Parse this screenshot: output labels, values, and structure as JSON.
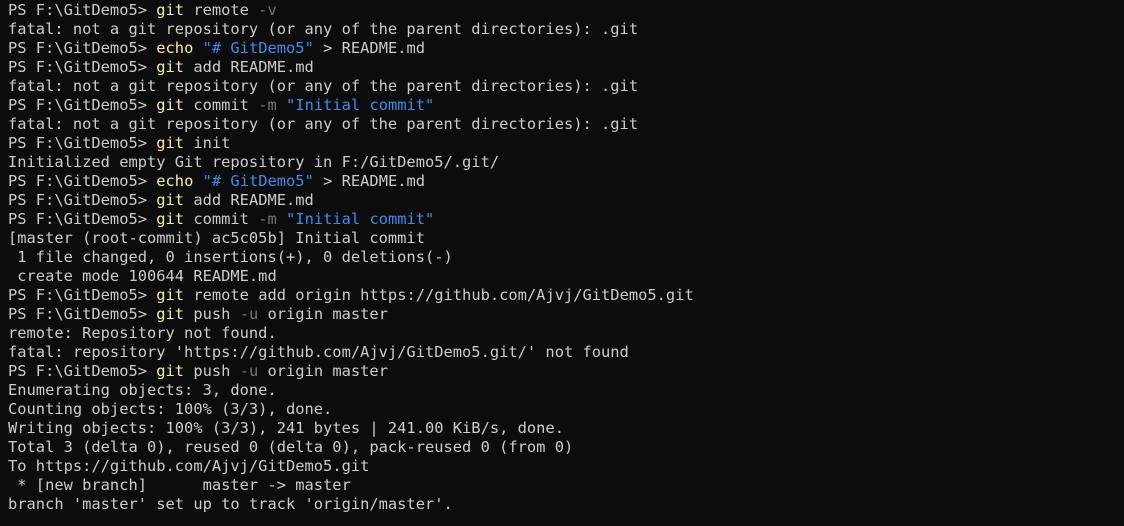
{
  "prompt": "PS F:\\GitDemo5> ",
  "lines": [
    {
      "type": "cmd",
      "tokens": [
        {
          "k": "cmd",
          "t": "git"
        },
        {
          "k": "arg",
          "t": " remote "
        },
        {
          "k": "flag",
          "t": "-v"
        }
      ]
    },
    {
      "type": "out",
      "text": "fatal: not a git repository (or any of the parent directories): .git"
    },
    {
      "type": "cmd",
      "tokens": [
        {
          "k": "cmd",
          "t": "echo"
        },
        {
          "k": "arg",
          "t": " "
        },
        {
          "k": "str",
          "t": "\"# GitDemo5\""
        },
        {
          "k": "arg",
          "t": " > README.md"
        }
      ]
    },
    {
      "type": "cmd",
      "tokens": [
        {
          "k": "cmd",
          "t": "git"
        },
        {
          "k": "arg",
          "t": " add README.md"
        }
      ]
    },
    {
      "type": "out",
      "text": "fatal: not a git repository (or any of the parent directories): .git"
    },
    {
      "type": "cmd",
      "tokens": [
        {
          "k": "cmd",
          "t": "git"
        },
        {
          "k": "arg",
          "t": " commit "
        },
        {
          "k": "flag",
          "t": "-m"
        },
        {
          "k": "arg",
          "t": " "
        },
        {
          "k": "str",
          "t": "\"Initial commit\""
        }
      ]
    },
    {
      "type": "out",
      "text": "fatal: not a git repository (or any of the parent directories): .git"
    },
    {
      "type": "cmd",
      "tokens": [
        {
          "k": "cmd",
          "t": "git"
        },
        {
          "k": "arg",
          "t": " init"
        }
      ]
    },
    {
      "type": "out",
      "text": "Initialized empty Git repository in F:/GitDemo5/.git/"
    },
    {
      "type": "cmd",
      "tokens": [
        {
          "k": "cmd",
          "t": "echo"
        },
        {
          "k": "arg",
          "t": " "
        },
        {
          "k": "str",
          "t": "\"# GitDemo5\""
        },
        {
          "k": "arg",
          "t": " > README.md"
        }
      ]
    },
    {
      "type": "cmd",
      "tokens": [
        {
          "k": "cmd",
          "t": "git"
        },
        {
          "k": "arg",
          "t": " add README.md"
        }
      ]
    },
    {
      "type": "cmd",
      "tokens": [
        {
          "k": "cmd",
          "t": "git"
        },
        {
          "k": "arg",
          "t": " commit "
        },
        {
          "k": "flag",
          "t": "-m"
        },
        {
          "k": "arg",
          "t": " "
        },
        {
          "k": "str",
          "t": "\"Initial commit\""
        }
      ]
    },
    {
      "type": "out",
      "text": "[master (root-commit) ac5c05b] Initial commit"
    },
    {
      "type": "out",
      "text": " 1 file changed, 0 insertions(+), 0 deletions(-)"
    },
    {
      "type": "out",
      "text": " create mode 100644 README.md"
    },
    {
      "type": "cmd",
      "tokens": [
        {
          "k": "cmd",
          "t": "git"
        },
        {
          "k": "arg",
          "t": " remote add origin https://github.com/Ajvj/GitDemo5.git"
        }
      ]
    },
    {
      "type": "cmd",
      "tokens": [
        {
          "k": "cmd",
          "t": "git"
        },
        {
          "k": "arg",
          "t": " push "
        },
        {
          "k": "flag",
          "t": "-u"
        },
        {
          "k": "arg",
          "t": " origin master"
        }
      ]
    },
    {
      "type": "out",
      "text": "remote: Repository not found."
    },
    {
      "type": "out",
      "text": "fatal: repository 'https://github.com/Ajvj/GitDemo5.git/' not found"
    },
    {
      "type": "cmd",
      "tokens": [
        {
          "k": "cmd",
          "t": "git"
        },
        {
          "k": "arg",
          "t": " push "
        },
        {
          "k": "flag",
          "t": "-u"
        },
        {
          "k": "arg",
          "t": " origin master"
        }
      ]
    },
    {
      "type": "out",
      "text": "Enumerating objects: 3, done."
    },
    {
      "type": "out",
      "text": "Counting objects: 100% (3/3), done."
    },
    {
      "type": "out",
      "text": "Writing objects: 100% (3/3), 241 bytes | 241.00 KiB/s, done."
    },
    {
      "type": "out",
      "text": "Total 3 (delta 0), reused 0 (delta 0), pack-reused 0 (from 0)"
    },
    {
      "type": "out",
      "text": "To https://github.com/Ajvj/GitDemo5.git"
    },
    {
      "type": "out",
      "text": " * [new branch]      master -> master"
    },
    {
      "type": "out",
      "text": "branch 'master' set up to track 'origin/master'."
    }
  ],
  "colors": {
    "background": "#0c0c0c",
    "text": "#cccccc",
    "command": "#f9f1a5",
    "string": "#3b8eea",
    "flag": "#767676"
  }
}
